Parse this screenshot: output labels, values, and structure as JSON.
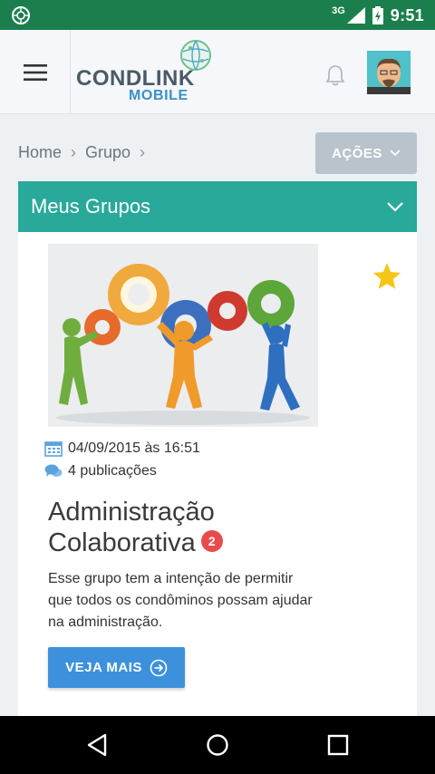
{
  "status_bar": {
    "network": "3G",
    "time": "9:51"
  },
  "app_bar": {
    "logo": {
      "line1": "CONDLINK",
      "line2": "MOBILE"
    }
  },
  "breadcrumb": {
    "items": [
      "Home",
      "Grupo"
    ]
  },
  "actions_button": {
    "label": "AÇÕES"
  },
  "panel": {
    "title": "Meus Grupos"
  },
  "group": {
    "favorite": true,
    "date": "04/09/2015 às 16:51",
    "posts": "4 publicações",
    "title": "Administração Colaborativa",
    "badge": "2",
    "description": "Esse grupo tem a intenção de permitir que todos os condôminos possam ajudar na administração.",
    "button_label": "VEJA MAIS"
  },
  "colors": {
    "status_bar": "#1b7f4d",
    "panel_header": "#28a99a",
    "primary_button": "#3d91dc",
    "actions_button": "#b9c3cc",
    "badge": "#e74c4c",
    "star": "#f5c518"
  },
  "icons": [
    "app-icon",
    "signal-icon",
    "battery-icon",
    "menu-icon",
    "globe-icon",
    "bell-icon",
    "avatar",
    "chevron-right-icon",
    "chevron-down-icon",
    "star-icon",
    "calendar-icon",
    "comments-icon",
    "arrow-circle-right-icon",
    "back-icon",
    "home-icon",
    "recents-icon"
  ]
}
